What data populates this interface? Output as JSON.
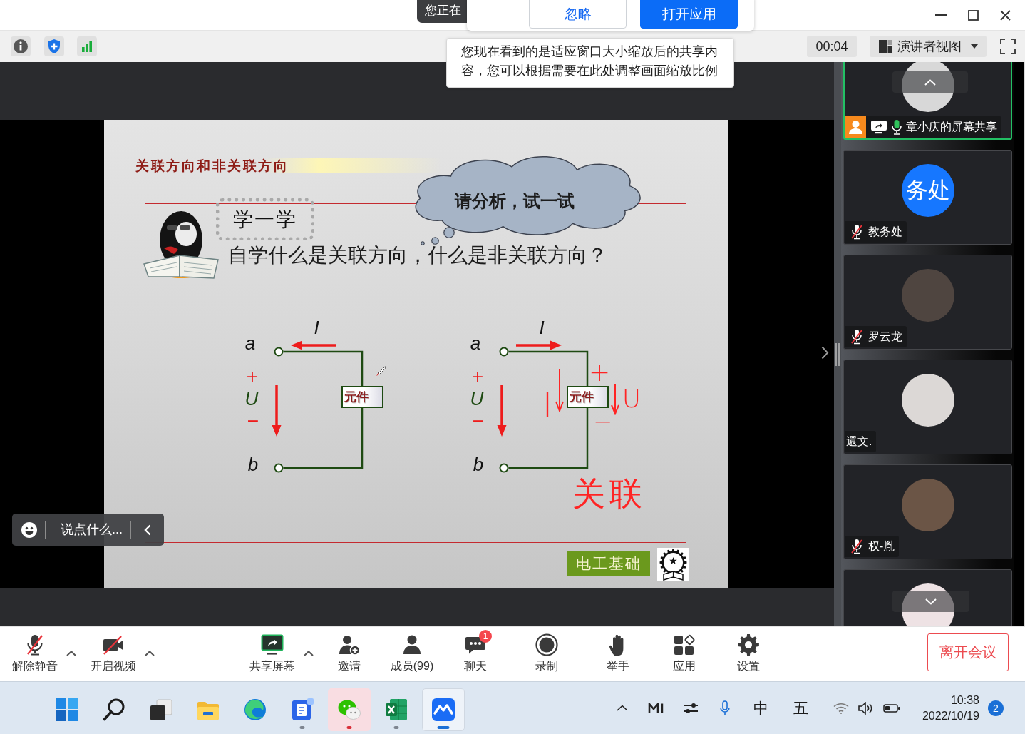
{
  "notification": {
    "tooltip": "您正在",
    "buttons": [
      {
        "label": "忽略",
        "primary": false
      },
      {
        "label": "打开应用",
        "primary": true
      }
    ]
  },
  "toolbar": {
    "timer": "00:04",
    "view_menu": "演讲者视图"
  },
  "zoom_tip": "您现在看到的是适应窗口大小缩放后的共享内容，您可以根据需要在此处调整画面缩放比例",
  "slide": {
    "title": "关联方向和非关联方向",
    "section_label": "学一学",
    "thought_cloud": "请分析，试一试",
    "question": "自学什么是关联方向，什么是非关联方向？",
    "circuits": [
      {
        "top_terminal": "a",
        "bottom_terminal": "b",
        "current": "I",
        "current_points_left": true,
        "plus": "+",
        "voltage": "U",
        "minus": "−",
        "element": "元件"
      },
      {
        "top_terminal": "a",
        "bottom_terminal": "b",
        "current": "I",
        "current_points_left": false,
        "plus": "+",
        "voltage": "U",
        "minus": "−",
        "element": "元件"
      }
    ],
    "annotations": [
      "I",
      "+",
      "U",
      "−",
      "关联"
    ],
    "footer_badge": "电工基础"
  },
  "chat_bar": {
    "placeholder": "说点什么..."
  },
  "participants": [
    {
      "name": "章小庆的屏幕共享",
      "kind": "photo",
      "active": true,
      "host": true,
      "sharing": true,
      "mic": {
        "muted": false
      }
    },
    {
      "name": "教务处",
      "kind": "initials",
      "initials": "务处",
      "active": false,
      "host": false,
      "sharing": false,
      "mic": {
        "muted": true
      }
    },
    {
      "name": "罗云龙",
      "kind": "photo",
      "active": false,
      "host": false,
      "sharing": false,
      "mic": {
        "muted": true
      }
    },
    {
      "name": "還文.",
      "kind": "photo",
      "active": false,
      "host": false,
      "sharing": false
    },
    {
      "name": "权-胤",
      "kind": "photo",
      "active": false,
      "host": false,
      "sharing": false,
      "mic": {
        "muted": true
      }
    },
    {
      "kind": "photo",
      "active": false,
      "host": false,
      "sharing": false
    }
  ],
  "controls": [
    {
      "label": "解除静音",
      "has_menu": true
    },
    {
      "label": "开启视频",
      "has_menu": true
    },
    {
      "label": "共享屏幕",
      "has_menu": true
    },
    {
      "label": "邀请",
      "has_menu": false
    },
    {
      "label": "成员(99)",
      "has_menu": false
    },
    {
      "label": "聊天",
      "has_menu": false,
      "badge": "1"
    },
    {
      "label": "录制",
      "has_menu": false
    },
    {
      "label": "举手",
      "has_menu": false
    },
    {
      "label": "应用",
      "has_menu": false
    },
    {
      "label": "设置",
      "has_menu": false
    }
  ],
  "leave_button": "离开会议",
  "taskbar": {
    "apps": [
      {
        "running": false,
        "selected": false,
        "attention": false
      },
      {
        "running": false,
        "selected": false,
        "attention": false
      },
      {
        "running": false,
        "selected": false,
        "attention": false
      },
      {
        "running": false,
        "selected": false,
        "attention": false
      },
      {
        "running": false,
        "selected": false,
        "attention": false
      },
      {
        "running": true,
        "selected": false,
        "attention": false
      },
      {
        "running": true,
        "selected": false,
        "attention": true
      },
      {
        "running": true,
        "selected": false,
        "attention": false
      },
      {
        "running": true,
        "selected": true,
        "attention": false
      }
    ],
    "tray": {
      "ime_mode": "中",
      "ime_input": "五",
      "time": "10:38",
      "date": "2022/10/19",
      "notification_count": "2"
    }
  }
}
